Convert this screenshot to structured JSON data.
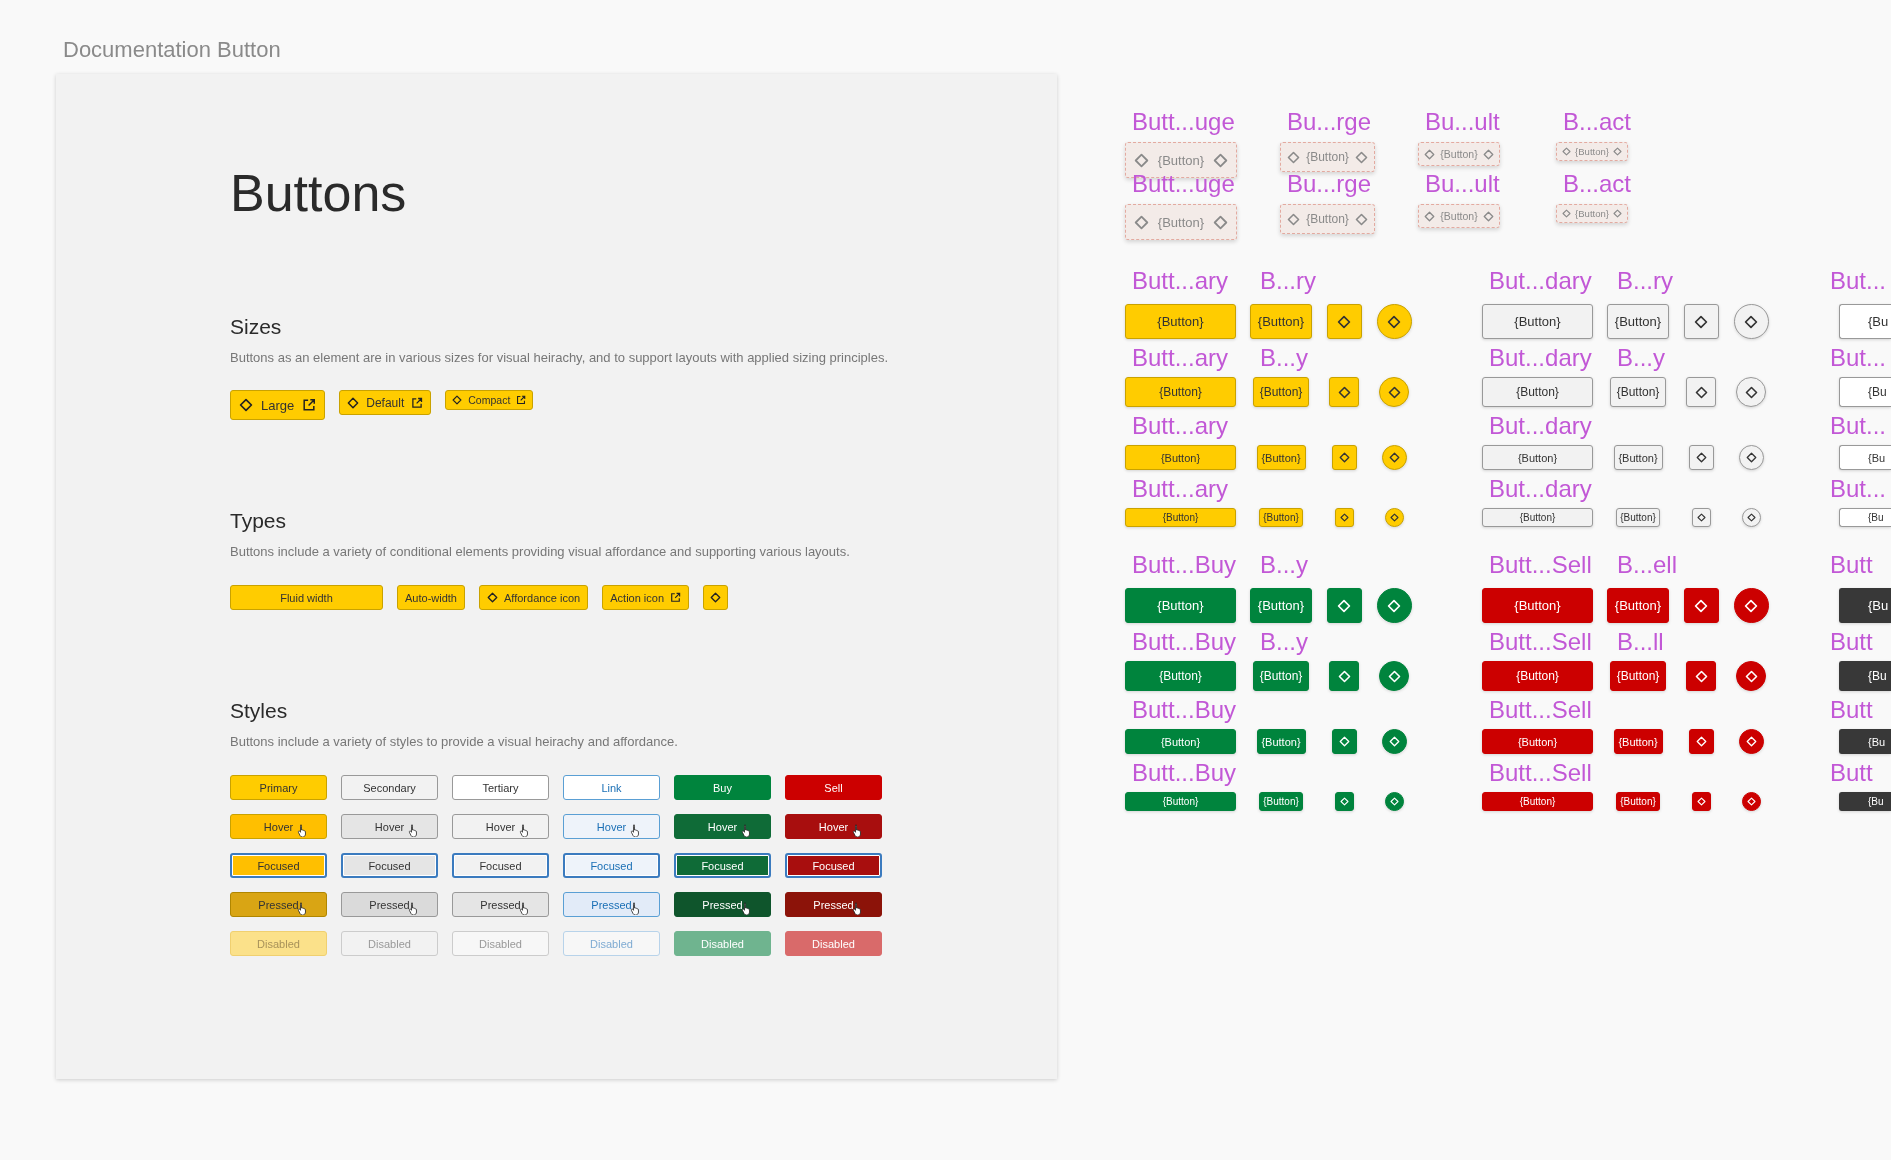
{
  "page_title": "Documentation Button",
  "doc": {
    "heading": "Buttons",
    "sections": [
      {
        "kind": "sizes",
        "heading": "Sizes",
        "description": "Buttons as an element are in various sizes for visual heirachy, and to support layouts with applied sizing principles.",
        "buttons": [
          "Large",
          "Default",
          "Compact"
        ]
      },
      {
        "kind": "types",
        "heading": "Types",
        "description": "Buttons include a variety of conditional elements providing visual affordance and supporting various layouts.",
        "buttons": [
          {
            "kind": "fluid",
            "text": "Fluid width"
          },
          {
            "kind": "auto",
            "text": "Auto-width"
          },
          {
            "kind": "affordance",
            "text": "Affordance icon"
          },
          {
            "kind": "action",
            "text": "Action icon"
          },
          {
            "kind": "icon"
          }
        ]
      },
      {
        "kind": "styles",
        "heading": "Styles",
        "description": "Buttons include a variety of styles to provide a visual heirachy and affordance.",
        "rows": [
          [
            "Primary",
            "Secondary",
            "Tertiary",
            "Link",
            "Buy",
            "Sell"
          ],
          [
            "Hover",
            "Hover",
            "Hover",
            "Hover",
            "Hover",
            "Hover"
          ],
          [
            "Focused",
            "Focused",
            "Focused",
            "Focused",
            "Focused",
            "Focused"
          ],
          [
            "Pressed",
            "Pressed",
            "Pressed",
            "Pressed",
            "Pressed",
            "Pressed"
          ],
          [
            "Disabled",
            "Disabled",
            "Disabled",
            "Disabled",
            "Disabled",
            "Disabled"
          ]
        ]
      }
    ]
  },
  "canvas": {
    "specimens": [
      {
        "label": "Butt...uge",
        "text": "{Button}"
      },
      {
        "label": "Bu...rge",
        "text": "{Button}"
      },
      {
        "label": "Bu...ult",
        "text": "{Button}"
      },
      {
        "label": "B...act",
        "text": "{Button}"
      },
      {
        "label": "Butt...uge",
        "text": "{Button}"
      },
      {
        "label": "Bu...rge",
        "text": "{Button}"
      },
      {
        "label": "Bu...ult",
        "text": "{Button}"
      },
      {
        "label": "B...act",
        "text": "{Button}"
      }
    ],
    "matrices": [
      {
        "labels": [
          "Butt...ary",
          "B...ry"
        ],
        "rows": [
          {
            "buttons": [
              {
                "kind": "fluid",
                "text": "{Button}"
              },
              {
                "kind": "auto",
                "text": "{Button}"
              },
              {
                "kind": "icon"
              },
              {
                "kind": "round"
              }
            ],
            "overlays": [
              "Butt...ary",
              "B...y"
            ]
          },
          {
            "buttons": [
              {
                "kind": "fluid",
                "text": "{Button}"
              },
              {
                "kind": "auto",
                "text": "{Button}"
              },
              {
                "kind": "icon"
              },
              {
                "kind": "round"
              }
            ],
            "overlays": [
              "Butt...ary"
            ]
          },
          {
            "buttons": [
              {
                "kind": "fluid",
                "text": "{Button}"
              },
              {
                "kind": "auto",
                "text": "{Button}"
              },
              {
                "kind": "icon"
              },
              {
                "kind": "round"
              }
            ],
            "overlays": [
              "Butt...ary"
            ]
          },
          {
            "buttons": [
              {
                "kind": "fluid",
                "text": "{Button}"
              },
              {
                "kind": "auto",
                "text": "{Button}"
              },
              {
                "kind": "icon"
              },
              {
                "kind": "round"
              }
            ]
          }
        ]
      },
      {
        "labels": [
          "But...dary",
          "B...ry"
        ],
        "rows": [
          {
            "buttons": [
              {
                "kind": "fluid",
                "text": "{Button}"
              },
              {
                "kind": "auto",
                "text": "{Button}"
              },
              {
                "kind": "icon"
              },
              {
                "kind": "round"
              }
            ],
            "overlays": [
              "But...dary",
              "B...y"
            ]
          },
          {
            "buttons": [
              {
                "kind": "fluid",
                "text": "{Button}"
              },
              {
                "kind": "auto",
                "text": "{Button}"
              },
              {
                "kind": "icon"
              },
              {
                "kind": "round"
              }
            ],
            "overlays": [
              "But...dary"
            ]
          },
          {
            "buttons": [
              {
                "kind": "fluid",
                "text": "{Button}"
              },
              {
                "kind": "auto",
                "text": "{Button}"
              },
              {
                "kind": "icon"
              },
              {
                "kind": "round"
              }
            ],
            "overlays": [
              "But...dary"
            ]
          },
          {
            "buttons": [
              {
                "kind": "fluid",
                "text": "{Button}"
              },
              {
                "kind": "auto",
                "text": "{Button}"
              },
              {
                "kind": "icon"
              },
              {
                "kind": "round"
              }
            ]
          }
        ]
      },
      {
        "labels": [
          "But..."
        ],
        "rows": [
          {
            "buttons": [
              {
                "kind": "cut",
                "text": "{Bu"
              }
            ],
            "overlays": [
              "But..."
            ]
          },
          {
            "buttons": [
              {
                "kind": "cut",
                "text": "{Bu"
              }
            ],
            "overlays": [
              "But..."
            ]
          },
          {
            "buttons": [
              {
                "kind": "cut",
                "text": "{Bu"
              }
            ],
            "overlays": [
              "But..."
            ]
          },
          {
            "buttons": [
              {
                "kind": "cut",
                "text": "{Bu"
              }
            ]
          }
        ]
      },
      {
        "labels": [
          "Butt...Buy",
          "B...y"
        ],
        "rows": [
          {
            "buttons": [
              {
                "kind": "fluid",
                "text": "{Button}"
              },
              {
                "kind": "auto",
                "text": "{Button}"
              },
              {
                "kind": "icon"
              },
              {
                "kind": "round"
              }
            ],
            "overlays": [
              "Butt...Buy",
              "B...y"
            ]
          },
          {
            "buttons": [
              {
                "kind": "fluid",
                "text": "{Button}"
              },
              {
                "kind": "auto",
                "text": "{Button}"
              },
              {
                "kind": "icon"
              },
              {
                "kind": "round"
              }
            ],
            "overlays": [
              "Butt...Buy"
            ]
          },
          {
            "buttons": [
              {
                "kind": "fluid",
                "text": "{Button}"
              },
              {
                "kind": "auto",
                "text": "{Button}"
              },
              {
                "kind": "icon"
              },
              {
                "kind": "round"
              }
            ],
            "overlays": [
              "Butt...Buy"
            ]
          },
          {
            "buttons": [
              {
                "kind": "fluid",
                "text": "{Button}"
              },
              {
                "kind": "auto",
                "text": "{Button}"
              },
              {
                "kind": "icon"
              },
              {
                "kind": "round"
              }
            ]
          }
        ]
      },
      {
        "labels": [
          "Butt...Sell",
          "B...ell"
        ],
        "rows": [
          {
            "buttons": [
              {
                "kind": "fluid",
                "text": "{Button}"
              },
              {
                "kind": "auto",
                "text": "{Button}"
              },
              {
                "kind": "icon"
              },
              {
                "kind": "round"
              }
            ],
            "overlays": [
              "Butt...Sell",
              "B...ll"
            ]
          },
          {
            "buttons": [
              {
                "kind": "fluid",
                "text": "{Button}"
              },
              {
                "kind": "auto",
                "text": "{Button}"
              },
              {
                "kind": "icon"
              },
              {
                "kind": "round"
              }
            ],
            "overlays": [
              "Butt...Sell"
            ]
          },
          {
            "buttons": [
              {
                "kind": "fluid",
                "text": "{Button}"
              },
              {
                "kind": "auto",
                "text": "{Button}"
              },
              {
                "kind": "icon"
              },
              {
                "kind": "round"
              }
            ],
            "overlays": [
              "Butt...Sell"
            ]
          },
          {
            "buttons": [
              {
                "kind": "fluid",
                "text": "{Button}"
              },
              {
                "kind": "auto",
                "text": "{Button}"
              },
              {
                "kind": "icon"
              },
              {
                "kind": "round"
              }
            ]
          }
        ]
      },
      {
        "labels": [
          "Butt"
        ],
        "rows": [
          {
            "buttons": [
              {
                "kind": "cut",
                "text": "{Bu"
              }
            ],
            "overlays": [
              "Butt"
            ]
          },
          {
            "buttons": [
              {
                "kind": "cut",
                "text": "{Bu"
              }
            ],
            "overlays": [
              "Butt"
            ]
          },
          {
            "buttons": [
              {
                "kind": "cut",
                "text": "{Bu"
              }
            ],
            "overlays": [
              "Butt"
            ]
          },
          {
            "buttons": [
              {
                "kind": "cut",
                "text": "{Bu"
              }
            ]
          }
        ]
      }
    ]
  }
}
